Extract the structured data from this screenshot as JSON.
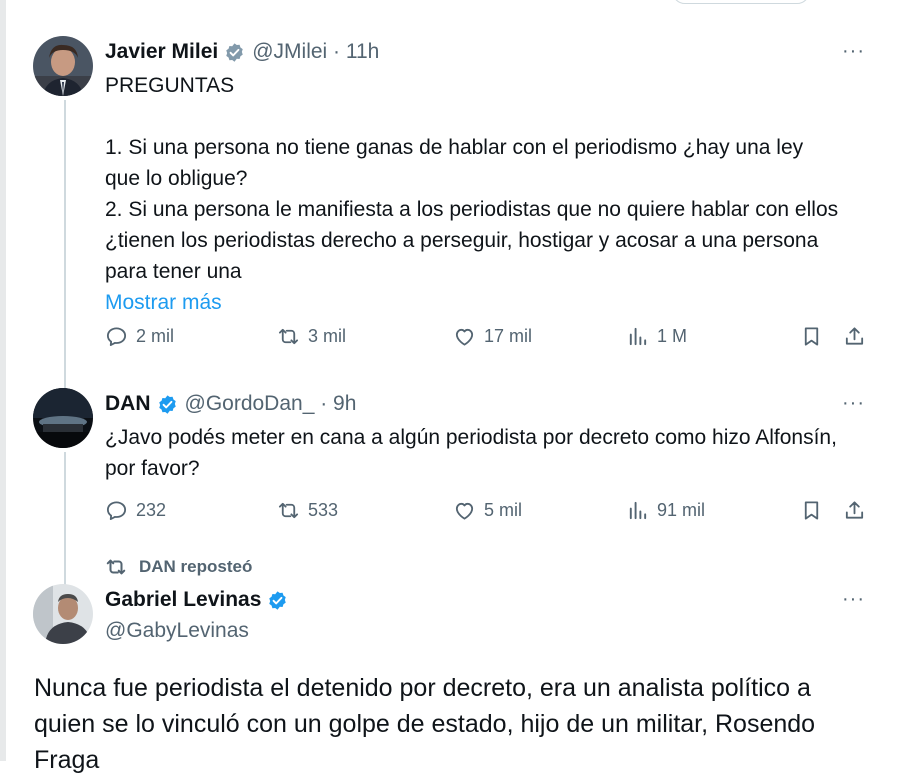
{
  "tweet1": {
    "name": "Javier Milei",
    "handle": "@JMilei · 11h",
    "more": "···",
    "title": "PREGUNTAS",
    "p1a": "1. Si una persona no tiene ganas de hablar con el periodismo ¿hay una ley",
    "p1b": "que lo obligue?",
    "p2a": "2. Si una persona le manifiesta a los periodistas que no quiere hablar con ellos",
    "p2b": "¿tienen los periodistas derecho a perseguir, hostigar y acosar a una persona",
    "p2c": "para tener una",
    "show_more": "Mostrar más",
    "replies": "2 mil",
    "reposts": "3 mil",
    "likes": "17 mil",
    "views": "1 M"
  },
  "tweet2": {
    "name": "DAN",
    "handle": "@GordoDan_ · 9h",
    "more": "···",
    "line1": "¿Javo podés meter en cana a algún periodista por decreto como hizo Alfonsín,",
    "line2": "por favor?",
    "replies": "232",
    "reposts": "533",
    "likes": "5 mil",
    "views": "91 mil"
  },
  "repost_notice": "DAN reposteó",
  "tweet3": {
    "name": "Gabriel Levinas",
    "handle": "@GabyLevinas",
    "more": "···",
    "line1": "Nunca fue periodista el detenido por decreto, era un analista político a",
    "line2": "quien se lo vinculó con un golpe de estado, hijo de un militar, Rosendo",
    "line3": "Fraga"
  },
  "icons": {
    "reply": "reply-icon",
    "repost": "repost-icon",
    "like": "heart-icon",
    "views": "views-icon",
    "bookmark": "bookmark-icon",
    "share": "share-icon",
    "verified": "verified-icon",
    "more": "more-icon"
  },
  "colors": {
    "text": "#0f1419",
    "secondary": "#536471",
    "link": "#1d9bf0",
    "verified": "#1d9bf0",
    "thread_line": "#cfd9de"
  }
}
